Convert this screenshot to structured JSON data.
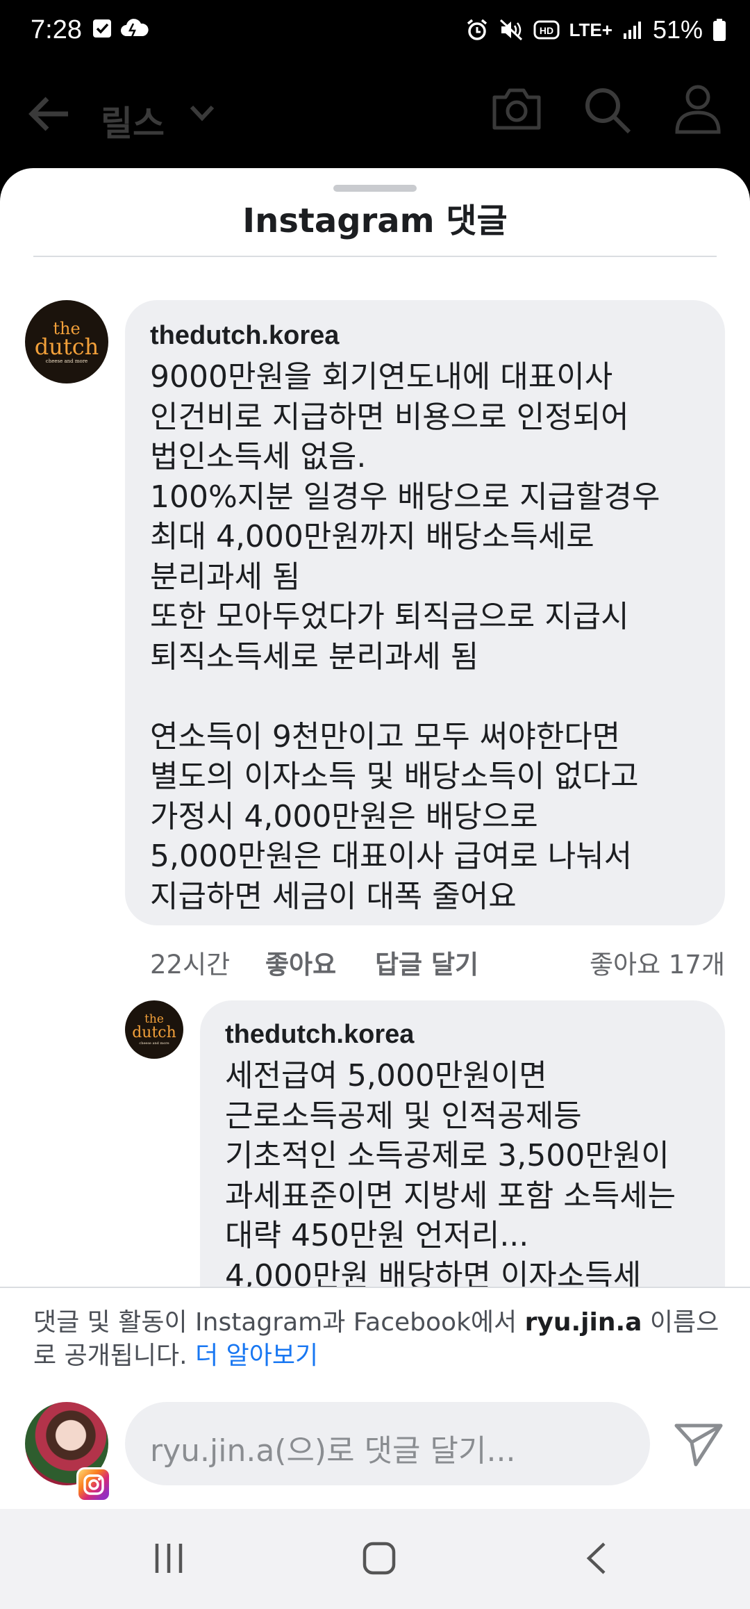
{
  "status_bar": {
    "time": "7:28",
    "network": "LTE+",
    "battery": "51%"
  },
  "background_app": {
    "title": "릴스"
  },
  "sheet": {
    "title": "Instagram 댓글"
  },
  "comments": [
    {
      "author": "thedutch.korea",
      "text": "9000만원을 회기연도내에 대표이사\n인건비로 지급하면 비용으로 인정되어\n법인소득세 없음.\n100%지분 일경우 배당으로 지급할경우\n최대 4,000만원까지 배당소득세로\n분리과세 됨\n또한 모아두었다가 퇴직금으로 지급시\n퇴직소득세로 분리과세 됨\n\n연소득이 9천만이고 모두 써야한다면\n별도의 이자소득 및 배당소득이 없다고\n가정시 4,000만원은 배당으로\n5,000만원은 대표이사 급여로 나눠서\n지급하면 세금이 대폭 줄어요",
      "time": "22시간",
      "like_label": "좋아요",
      "reply_label": "답글 달기",
      "likes": "좋아요 17개"
    },
    {
      "author": "thedutch.korea",
      "text": "세전급여 5,000만원이면\n근로소득공제 및 인적공제등\n기초적인 소득공제로 3,500만원이\n과세표준이면 지방세 포함 소득세는\n대략 450만원 언저리...\n4,000만원 배당하면 이자소득세"
    }
  ],
  "avatar_logo": {
    "line1": "the",
    "line2": "dutch",
    "line3": "cheese and more"
  },
  "footer": {
    "notice_pre": "댓글 및 활동이 Instagram과 Facebook에서 ",
    "notice_user": "ryu.jin.a",
    "notice_mid": " 이름으로 공개됩니다. ",
    "notice_link": "더 알아보기",
    "input_placeholder": "ryu.jin.a(으)로 댓글 달기..."
  },
  "icons": {
    "status_left": [
      "checkbox-icon",
      "cloud-icon"
    ],
    "status_right": [
      "alarm-icon",
      "mute-icon",
      "hd-icon",
      "signal-icon",
      "battery-icon"
    ],
    "app_bar": [
      "back-arrow-icon",
      "chevron-down-icon",
      "camera-icon",
      "search-icon",
      "profile-icon"
    ],
    "nav": [
      "recent-apps-icon",
      "home-icon",
      "back-icon"
    ],
    "send": "send-icon",
    "instagram": "instagram-icon"
  },
  "colors": {
    "link": "#1877f2",
    "bubble": "#eeeff2",
    "logo_orange": "#f2a03a"
  }
}
